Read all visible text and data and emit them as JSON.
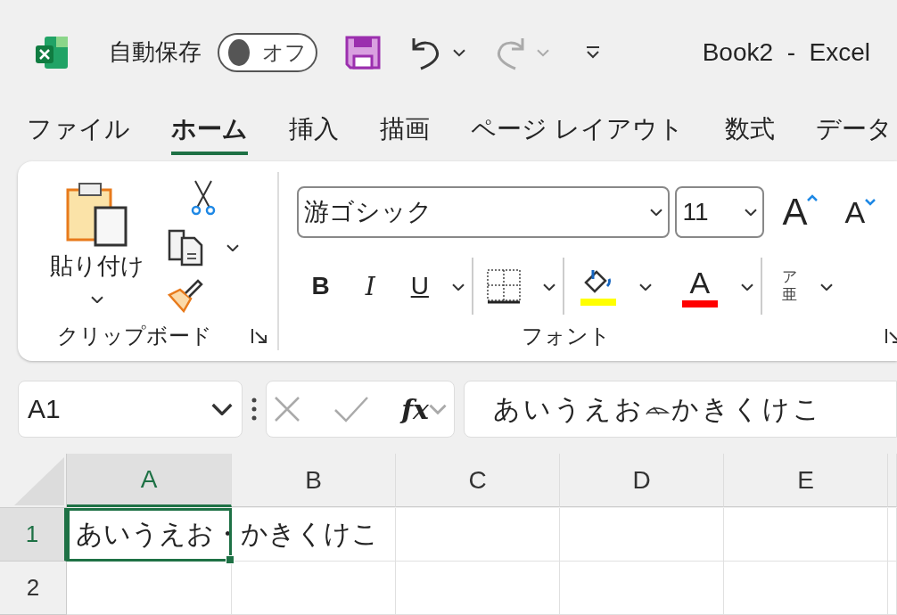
{
  "title_bar": {
    "autosave_label": "自動保存",
    "autosave": {
      "on": false,
      "label": "オフ"
    },
    "title": "Book2  -  Excel"
  },
  "menu_tabs": [
    {
      "label": "ファイル",
      "selected": false
    },
    {
      "label": "ホーム",
      "selected": true
    },
    {
      "label": "挿入",
      "selected": false
    },
    {
      "label": "描画",
      "selected": false
    },
    {
      "label": "ページ レイアウト",
      "selected": false
    },
    {
      "label": "数式",
      "selected": false
    },
    {
      "label": "データ",
      "selected": false
    }
  ],
  "ribbon": {
    "clipboard": {
      "paste_label": "貼り付け",
      "group_label": "クリップボード"
    },
    "font": {
      "font_name": "游ゴシック",
      "font_size": "11",
      "grow": "A",
      "shrink": "A",
      "bold": "B",
      "italic": "I",
      "underline": "U",
      "font_color": "A",
      "phonetic_top": "ア",
      "phonetic_bottom": "亜",
      "group_label": "フォント"
    }
  },
  "formula_bar": {
    "name_box": "A1",
    "fx": "fx",
    "formula_before": "あいうえお",
    "formula_after": "かきくけこ"
  },
  "sheet": {
    "columns": [
      {
        "label": "A",
        "selected": true
      },
      {
        "label": "B",
        "selected": false
      },
      {
        "label": "C",
        "selected": false
      },
      {
        "label": "D",
        "selected": false
      },
      {
        "label": "E",
        "selected": false
      }
    ],
    "rows": [
      {
        "header": "1",
        "selected": true,
        "value": "あいうえお・かきくけこ"
      },
      {
        "header": "2",
        "selected": false
      }
    ]
  }
}
